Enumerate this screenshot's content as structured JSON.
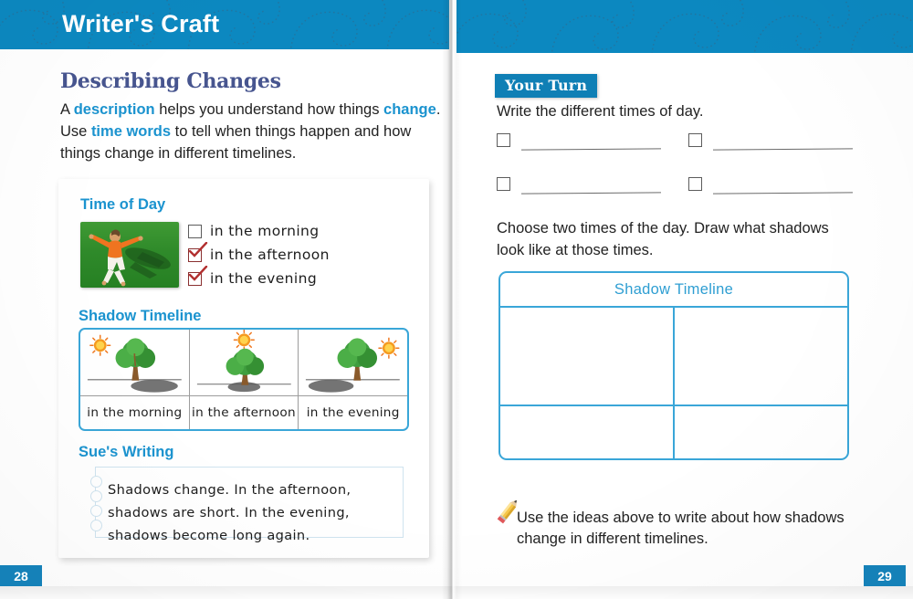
{
  "header": {
    "title": "Writer's Craft",
    "band_color": "#0c88c0"
  },
  "left_page": {
    "number": "28",
    "heading": "Describing Changes",
    "intro": {
      "part1": "A ",
      "kw1": "description",
      "part2": " helps you understand how things ",
      "kw2": "change",
      "part3": ". Use ",
      "kw3": "time words",
      "part4": " to tell when things happen and how things change in different timelines."
    },
    "time_of_day": {
      "heading": "Time of Day",
      "photo_alt": "girl-jumping-on-grass-with-shadow",
      "options": [
        {
          "label": "in the morning",
          "checked": false
        },
        {
          "label": "in the afternoon",
          "checked": true
        },
        {
          "label": "in the evening",
          "checked": true
        }
      ]
    },
    "shadow_timeline": {
      "heading": "Shadow Timeline",
      "cells": [
        {
          "caption": "in the morning",
          "sun_position": "left",
          "shadow_direction": "right",
          "shadow_length": "long"
        },
        {
          "caption": "in the afternoon",
          "sun_position": "top",
          "shadow_direction": "below",
          "shadow_length": "short"
        },
        {
          "caption": "in the evening",
          "sun_position": "right",
          "shadow_direction": "left",
          "shadow_length": "long"
        }
      ]
    },
    "sues_writing": {
      "heading": "Sue's Writing",
      "line1": "Shadows change. In the afternoon,",
      "line2": "shadows are short. In the evening,",
      "line3": "shadows become long again."
    }
  },
  "right_page": {
    "number": "29",
    "your_turn_badge": "Your Turn",
    "prompt1": "Write the different times of day.",
    "answer_rows": [
      [
        {
          "checked": false,
          "value": ""
        },
        {
          "checked": false,
          "value": ""
        }
      ],
      [
        {
          "checked": false,
          "value": ""
        },
        {
          "checked": false,
          "value": ""
        }
      ]
    ],
    "prompt2": "Choose two times of the day. Draw what shadows look like at those times.",
    "grid": {
      "title": "Shadow Timeline",
      "rows": 2,
      "cols": 2
    },
    "pencil_note": {
      "icon": "pencil-icon",
      "text": "Use the ideas above to write about how shadows change in different timelines."
    }
  },
  "colors": {
    "band_blue": "#0c88c0",
    "accent_blue": "#1b93cf",
    "heading_navy": "#47558f",
    "box_border": "#3aa6d8",
    "check_red": "#b33232",
    "page_tab": "#1581b8"
  }
}
